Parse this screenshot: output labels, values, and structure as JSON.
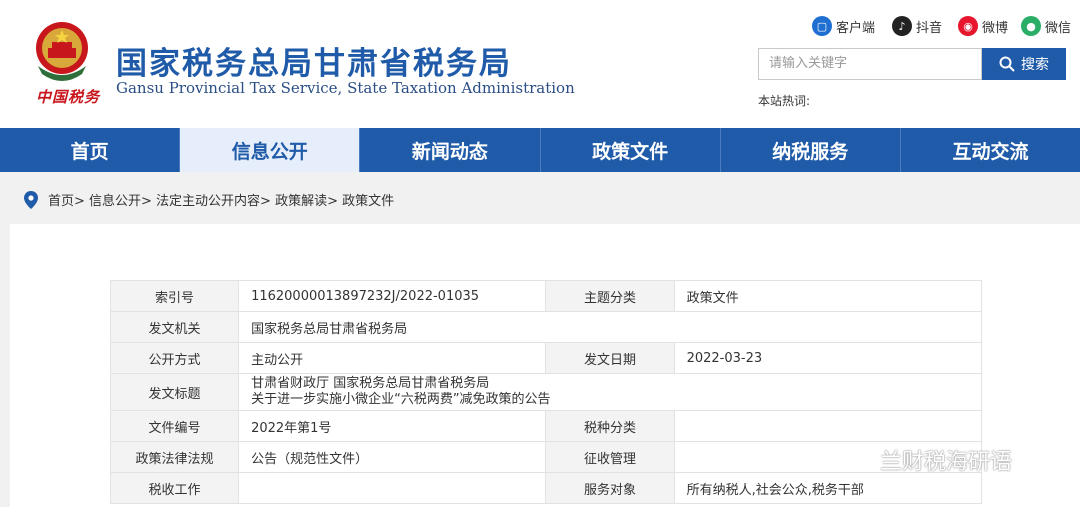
{
  "header": {
    "logo_text": "中国税务",
    "title_cn": "国家税务总局甘肃省税务局",
    "title_en": "Gansu Provincial Tax Service, State Taxation Administration"
  },
  "social": [
    {
      "label": "客户端",
      "icon": "client-icon",
      "color": "#1f6fd1"
    },
    {
      "label": "抖音",
      "icon": "tiktok-icon",
      "color": "#222222"
    },
    {
      "label": "微博",
      "icon": "weibo-icon",
      "color": "#e6162d"
    },
    {
      "label": "微信",
      "icon": "wechat-icon",
      "color": "#2aae67"
    }
  ],
  "search": {
    "placeholder": "请输入关键字",
    "button": "搜索",
    "hot_label": "本站热词:"
  },
  "nav": [
    {
      "label": "首页"
    },
    {
      "label": "信息公开",
      "active": true
    },
    {
      "label": "新闻动态"
    },
    {
      "label": "政策文件"
    },
    {
      "label": "纳税服务"
    },
    {
      "label": "互动交流"
    }
  ],
  "breadcrumb": "首页> 信息公开> 法定主动公开内容> 政策解读> 政策文件",
  "meta": {
    "index_label": "索引号",
    "index_value": "11620000013897232J/2022-01035",
    "topic_label": "主题分类",
    "topic_value": "政策文件",
    "issuer_label": "发文机关",
    "issuer_value": "国家税务总局甘肃省税务局",
    "open_label": "公开方式",
    "open_value": "主动公开",
    "date_label": "发文日期",
    "date_value": "2022-03-23",
    "doc_title_label": "发文标题",
    "doc_title_line1": "甘肃省财政厅 国家税务总局甘肃省税务局",
    "doc_title_line2": "关于进一步实施小微企业“六税两费”减免政策的公告",
    "docno_label": "文件编号",
    "docno_value": "2022年第1号",
    "taxtype_label": "税种分类",
    "taxtype_value": "",
    "law_label": "政策法律法规",
    "law_value": "公告（规范性文件）",
    "collect_label": "征收管理",
    "collect_value": "",
    "taxwork_label": "税收工作",
    "taxwork_value": "",
    "service_label": "服务对象",
    "service_value": "所有纳税人,社会公众,税务干部"
  },
  "watermark": "兰财税海研语"
}
